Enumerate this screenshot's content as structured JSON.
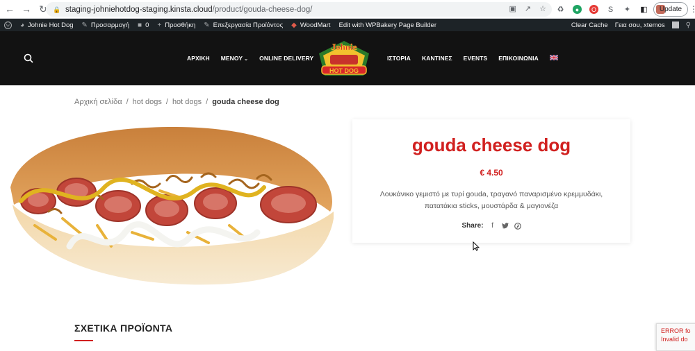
{
  "browser": {
    "url_host": "staging-johniehotdog-staging.kinsta.cloud",
    "url_path": "/product/gouda-cheese-dog/",
    "update_label": "Update"
  },
  "adminbar": {
    "site_name": "Johnie Hot Dog",
    "customize": "Προσαρμογή",
    "comments_count": "0",
    "new": "Προσθήκη",
    "edit_product": "Επεξεργασία Προϊόντος",
    "woodmart": "WoodMart",
    "wpbakery": "Edit with WPBakery Page Builder",
    "clear_cache": "Clear Cache",
    "greeting": "Γεια σου, xtemos"
  },
  "header": {
    "menu_left": [
      "ΑΡΧΙΚΗ",
      "ΜΕΝΟΥ",
      "ONLINE DELIVERY"
    ],
    "menu_right": [
      "ΙΣΤΟΡΙΑ",
      "ΚΑΝΤΙΝΕΣ",
      "EVENTS",
      "ΕΠΙΚΟΙΝΩΝΙΑ"
    ],
    "logo_text_top": "Johnie",
    "logo_text_bottom": "HOT DOG"
  },
  "breadcrumb": {
    "items": [
      "Αρχική σελίδα",
      "hot dogs",
      "hot dogs"
    ],
    "separator": "/",
    "current": "gouda cheese dog"
  },
  "product": {
    "title": "gouda cheese dog",
    "price": "€ 4.50",
    "description": "Λουκάνικο γεμιστό με τυρί gouda, τραγανό παναρισμένο κρεμμυδάκι, πατατάκια sticks, μουστάρδα & μαγιονέζα",
    "share_label": "Share:"
  },
  "related": {
    "title": "ΣΧΕΤΙΚΑ ΠΡΟΪΟΝΤΑ"
  },
  "recaptcha": {
    "line1": "ERROR fo",
    "line2": "Invalid do"
  },
  "colors": {
    "accent": "#d1201f",
    "header_bg": "#121212",
    "adminbar_bg": "#1d2327"
  }
}
